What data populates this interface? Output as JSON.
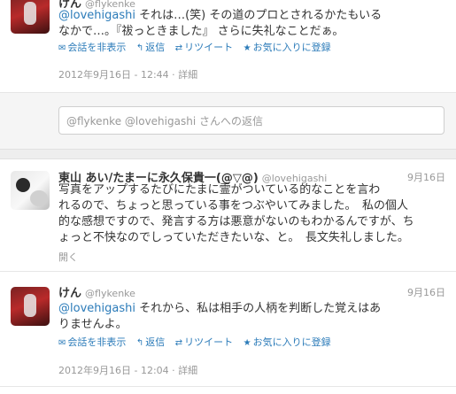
{
  "tweet1": {
    "name": "けん",
    "handle": "@flykenke",
    "mention": "@lovehigashi",
    "line1_rest": " それは…(笑) その道のプロとされるかたもいる",
    "line2": "なかで…。『祓っときました』 さらに失礼なことだぁ。",
    "actions": {
      "hide": "会話を非表示",
      "reply": "返信",
      "retweet": "リツイート",
      "fav": "お気に入りに登録"
    },
    "datetime": "2012年9月16日 - 12:44",
    "details": "詳細"
  },
  "reply_box": {
    "placeholder": "@flykenke @lovehigashi さんへの返信"
  },
  "tweet2": {
    "name": "東山 あい/たまーに永久保貴一(@▽@)",
    "handle": "@lovehigashi",
    "time": "9月16日",
    "lines": [
      "写真をアップするたびにたまに霊がついている的なことを言わ",
      "れるので、ちょっと思っている事をつぶやいてみました。　私の個人",
      "的な感想ですので、発言する方は悪意がないのもわかるんですが、ち",
      "ょっと不快なのでしっていただきたいな、と。　長文失礼しました。"
    ],
    "open": "開く"
  },
  "tweet3": {
    "name": "けん",
    "handle": "@flykenke",
    "time": "9月16日",
    "mention": "@lovehigashi",
    "line1_rest": " それから、私は相手の人柄を判断した覚えはあ",
    "line2": "りませんよ。",
    "actions": {
      "hide": "会話を非表示",
      "reply": "返信",
      "retweet": "リツイート",
      "fav": "お気に入りに登録"
    },
    "datetime": "2012年9月16日 - 12:04",
    "details": "詳細"
  },
  "icons": {
    "hide": "speech-bubble-icon",
    "reply": "reply-arrow-icon",
    "retweet": "retweet-icon",
    "fav": "star-icon"
  },
  "colors": {
    "link": "#2b7bb9",
    "muted": "#999999",
    "text": "#333333"
  }
}
